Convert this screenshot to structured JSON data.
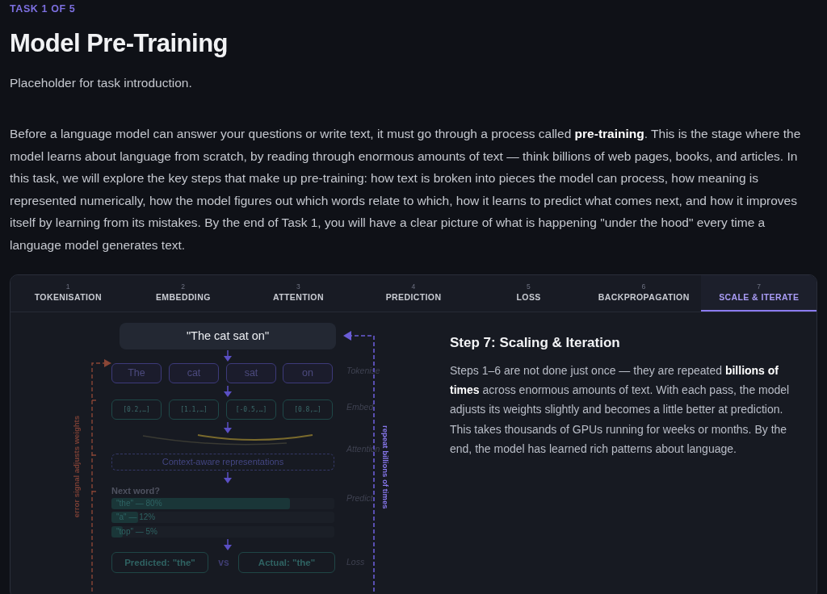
{
  "eyebrow": "TASK 1 OF 5",
  "title": "Model Pre-Training",
  "intro": "Placeholder for task introduction.",
  "body": "Before a language model can answer your questions or write text, it must go through a process called **pre-training**. This is the stage where the model learns about language from scratch, by reading through enormous amounts of text — think billions of web pages, books, and articles. In this task, we will explore the key steps that make up pre-training: how text is broken into pieces the model can process, how meaning is represented numerically, how the model figures out which words relate to which, how it learns to predict what comes next, and how it improves itself by learning from its mistakes. By the end of Task 1, you will have a clear picture of what is happening \"under the hood\" every time a language model generates text.",
  "tabs": [
    {
      "number": "1",
      "label": "TOKENISATION",
      "selected": false
    },
    {
      "number": "2",
      "label": "EMBEDDING",
      "selected": false
    },
    {
      "number": "3",
      "label": "ATTENTION",
      "selected": false
    },
    {
      "number": "4",
      "label": "PREDICTION",
      "selected": false
    },
    {
      "number": "5",
      "label": "LOSS",
      "selected": false
    },
    {
      "number": "6",
      "label": "BACKPROPAGATION",
      "selected": false
    },
    {
      "number": "7",
      "label": "SCALE & ITERATE",
      "selected": true
    }
  ],
  "diagram": {
    "sentence": "\"The cat sat on\"",
    "tokens": [
      "The",
      "cat",
      "sat",
      "on"
    ],
    "embeddings": [
      "[0.2,…]",
      "[1.1,…]",
      "[-0.5,…]",
      "[0.8,…]"
    ],
    "context": "Context-aware representations",
    "next_word_label": "Next word?",
    "predictions": [
      {
        "text": "\"the\" — 80%",
        "level": 0.8
      },
      {
        "text": "\"a\" — 12%",
        "level": 0.12
      },
      {
        "text": "\"top\" — 5%",
        "level": 0.05
      }
    ],
    "predicted": "Predicted: \"the\"",
    "versus": "vs",
    "actual": "Actual: \"the\"",
    "stages": [
      "Tokenise",
      "Embed",
      "Attention",
      "Predict",
      "Loss"
    ],
    "repeat_label": "repeat billions of times",
    "error_label": "error signal adjusts weights"
  },
  "step": {
    "heading": "Step 7: Scaling & Iteration",
    "text": "Steps 1–6 are not done just once — they are repeated **billions of times** across enormous amounts of text. With each pass, the model adjusts its weights slightly and becomes a little better at prediction. This takes thousands of GPUs running for weeks or months. By the end, the model has learned rich patterns about language."
  }
}
